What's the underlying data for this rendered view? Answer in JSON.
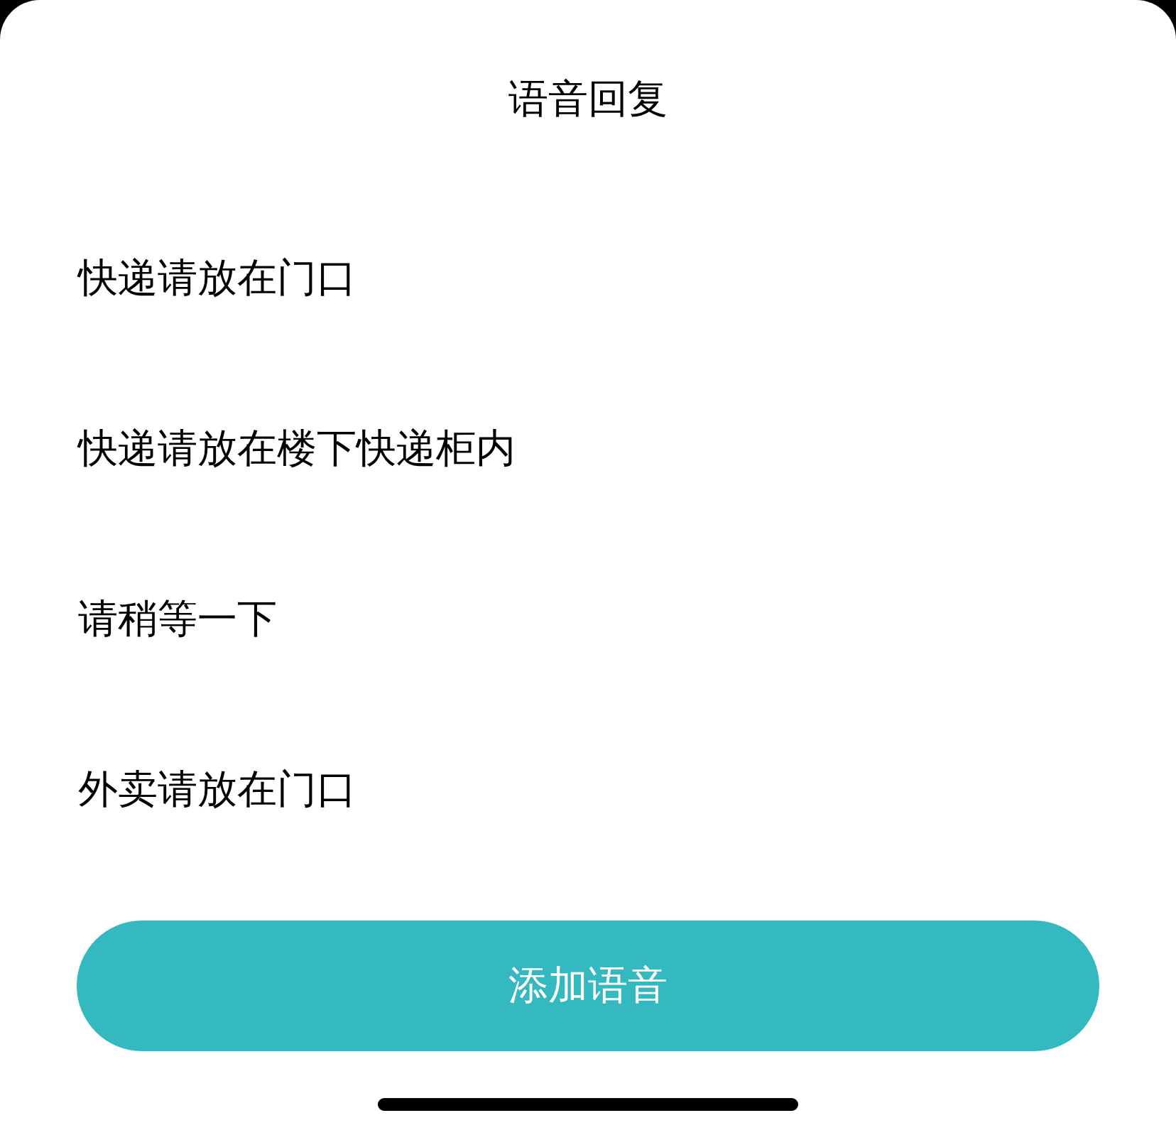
{
  "title": "语音回复",
  "replies": [
    "快递请放在门口",
    "快递请放在楼下快递柜内",
    "请稍等一下",
    "外卖请放在门口"
  ],
  "add_button": "添加语音"
}
